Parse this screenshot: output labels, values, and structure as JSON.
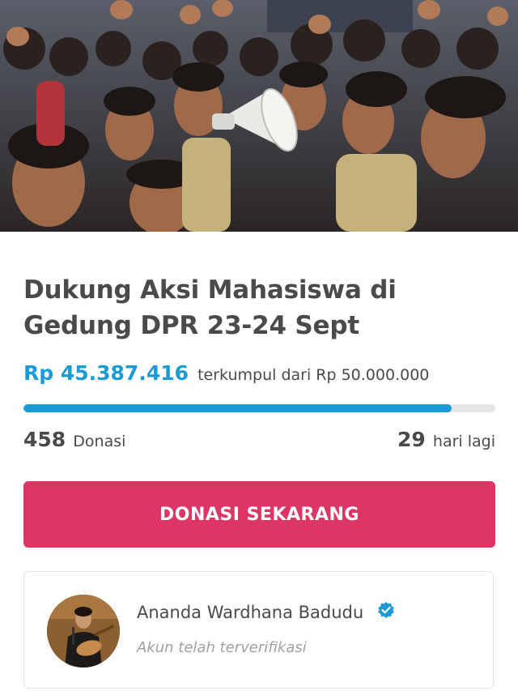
{
  "campaign": {
    "title": "Dukung Aksi Mahasiswa di Gedung DPR 23-24 Sept",
    "amount_raised": "Rp 45.387.416",
    "amount_suffix": "terkumpul dari Rp 50.000.000",
    "progress_fraction": 0.9077,
    "donations_count": "458",
    "donations_label": "Donasi",
    "days_left": "29",
    "days_left_label": "hari lagi"
  },
  "cta": {
    "donate_label": "DONASI SEKARANG"
  },
  "organizer": {
    "name": "Ananda Wardhana Badudu",
    "status": "Akun telah terverifikasi"
  },
  "colors": {
    "accent_blue": "#1b9ad6",
    "donate_pink": "#dd3664",
    "text_dark": "#4a4a4a",
    "text_muted": "#a0a0a0"
  },
  "icons": {
    "hero": "protest-crowd-photo",
    "verified": "verified-check-icon",
    "avatar": "organizer-avatar-photo"
  }
}
